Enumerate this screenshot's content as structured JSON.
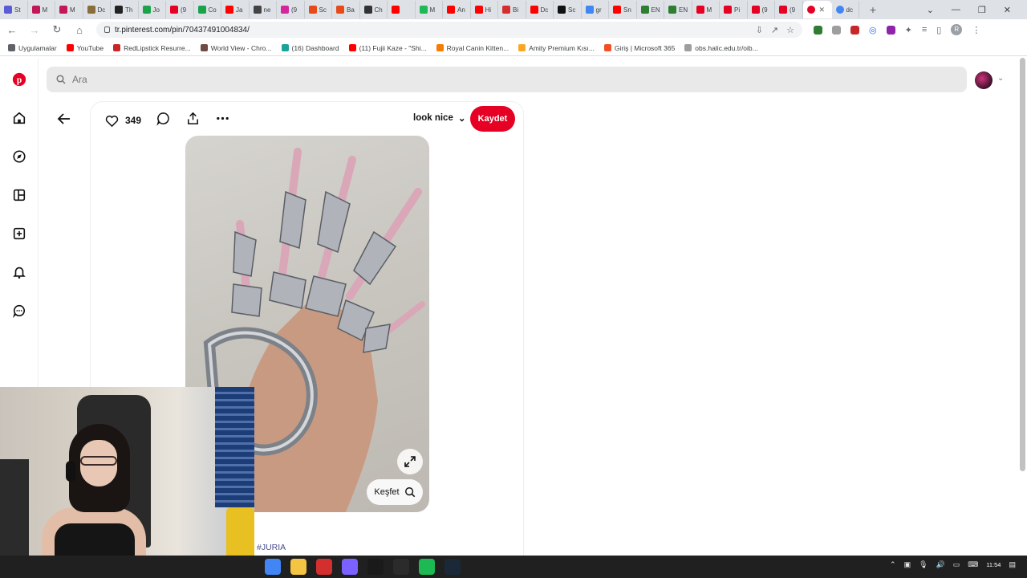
{
  "browser": {
    "tabs": [
      {
        "label": "St",
        "color": "#5b5bd6"
      },
      {
        "label": "M",
        "color": "#c2185b"
      },
      {
        "label": "M",
        "color": "#c2185b"
      },
      {
        "label": "Dc",
        "color": "#8a6d3b"
      },
      {
        "label": "Th",
        "color": "#222222"
      },
      {
        "label": "Jo",
        "color": "#1aa34a"
      },
      {
        "label": "(9",
        "color": "#e60023"
      },
      {
        "label": "Co",
        "color": "#1aa34a"
      },
      {
        "label": "Ja",
        "color": "#ff0000"
      },
      {
        "label": "ne",
        "color": "#444444"
      },
      {
        "label": "(9",
        "color": "#d6249f"
      },
      {
        "label": "Sc",
        "color": "#e64a19"
      },
      {
        "label": "Ba",
        "color": "#e64a19"
      },
      {
        "label": "Ch",
        "color": "#333333"
      },
      {
        "label": "",
        "color": "#ff0000"
      },
      {
        "label": "M",
        "color": "#1db954"
      },
      {
        "label": "An",
        "color": "#ff0000"
      },
      {
        "label": "Hi",
        "color": "#ff0000"
      },
      {
        "label": "Bi",
        "color": "#d32f2f"
      },
      {
        "label": "Dc",
        "color": "#ff0000"
      },
      {
        "label": "Sc",
        "color": "#111111"
      },
      {
        "label": "gr",
        "color": "#4285f4"
      },
      {
        "label": "Sn",
        "color": "#ff0000"
      },
      {
        "label": "EN",
        "color": "#2e7d32"
      },
      {
        "label": "EN",
        "color": "#2e7d32"
      },
      {
        "label": "M",
        "color": "#e60023"
      },
      {
        "label": "Pi",
        "color": "#e60023"
      },
      {
        "label": "(9",
        "color": "#e60023"
      },
      {
        "label": "(9",
        "color": "#e60023"
      }
    ],
    "active_tab": {
      "label": "",
      "color": "#e60023"
    },
    "last_tab": {
      "label": "dc",
      "color": "#4285f4"
    },
    "url": "tr.pinterest.com/pin/70437491004834/",
    "profile_initial": "R",
    "bookmarks": [
      {
        "label": "Uygulamalar",
        "color": "#5f6368"
      },
      {
        "label": "YouTube",
        "color": "#ff0000"
      },
      {
        "label": "RedLipstick Resurre...",
        "color": "#c62828"
      },
      {
        "label": "World View - Chro...",
        "color": "#6d4c41"
      },
      {
        "label": "(16) Dashboard",
        "color": "#1aa39a"
      },
      {
        "label": "(11) Fujii Kaze - \"Shi...",
        "color": "#ff0000"
      },
      {
        "label": "Royal Canin Kitten...",
        "color": "#f57c00"
      },
      {
        "label": "Amity Premium Kısı...",
        "color": "#f9a825"
      },
      {
        "label": "Giriş | Microsoft 365",
        "color": "#f25022"
      },
      {
        "label": "obs.halic.edu.tr/oib...",
        "color": "#9e9e9e"
      }
    ]
  },
  "pinterest": {
    "search_placeholder": "Ara",
    "like_count": "349",
    "board_name": "look nice",
    "save_label": "Kaydet",
    "explore_label": "Keşfet",
    "hashtag": "#JURIA",
    "brand_color": "#e60023"
  },
  "taskbar": {
    "time": "11:54",
    "apps": [
      {
        "color": "#4285f4"
      },
      {
        "color": "#f4c542"
      },
      {
        "color": "#d32f2f"
      },
      {
        "color": "#7b61ff"
      },
      {
        "color": "#1a1a1a"
      },
      {
        "color": "#2b2b2b"
      },
      {
        "color": "#1db954"
      },
      {
        "color": "#1b2838"
      }
    ]
  }
}
